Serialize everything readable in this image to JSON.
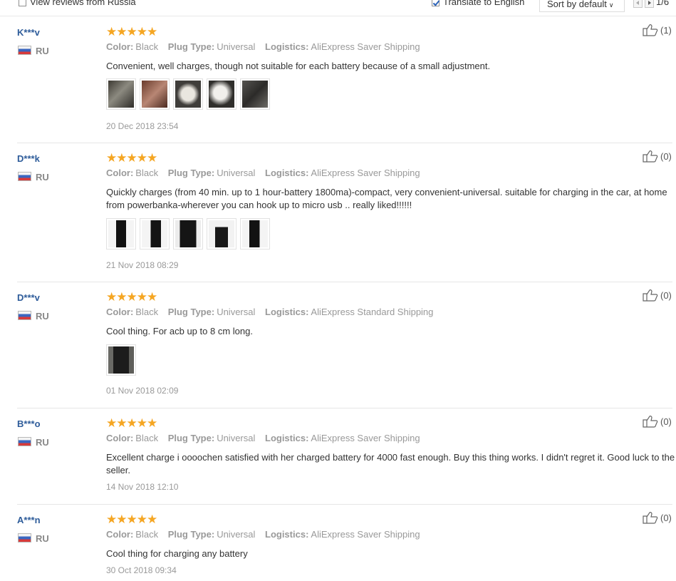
{
  "top_bar": {
    "view_reviews_from": "View reviews from Russia",
    "translate": "Translate to English",
    "sort": "Sort by default",
    "page": "1/6"
  },
  "labels": {
    "color": "Color:",
    "plug_type": "Plug Type:",
    "logistics": "Logistics:"
  },
  "reviews": [
    {
      "name": "K***v",
      "country": "RU",
      "stars": "★★★★★",
      "rating": 5,
      "color": "Black",
      "plug_type": "Universal",
      "logistics": "AliExpress Saver Shipping",
      "text": "Convenient, well charges, though not suitable for each battery because of a small adjustment.",
      "photos": 5,
      "date": "20 Dec 2018 23:54",
      "helpful": "(1)"
    },
    {
      "name": "D***k",
      "country": "RU",
      "stars": "★★★★★",
      "rating": 5,
      "color": "Black",
      "plug_type": "Universal",
      "logistics": "AliExpress Saver Shipping",
      "text": "Quickly charges (from 40 min. up to 1 hour-battery 1800ma)-compact, very convenient-universal. suitable for charging in the car, at home from powerbanka-wherever you can hook up to micro usb .. really liked!!!!!!",
      "photos": 5,
      "date": "21 Nov 2018 08:29",
      "helpful": "(0)"
    },
    {
      "name": "D***v",
      "country": "RU",
      "stars": "★★★★★",
      "rating": 5,
      "color": "Black",
      "plug_type": "Universal",
      "logistics": "AliExpress Standard Shipping",
      "text": "Cool thing. For acb up to 8 cm long.",
      "photos": 1,
      "date": "01 Nov 2018 02:09",
      "helpful": "(0)"
    },
    {
      "name": "B***o",
      "country": "RU",
      "stars": "★★★★★",
      "rating": 5,
      "color": "Black",
      "plug_type": "Universal",
      "logistics": "AliExpress Saver Shipping",
      "text": "Excellent charge i oooochen satisfied with her charged battery for 4000 fast enough. Buy this thing works. I didn't regret it. Good luck to the seller.",
      "photos": 0,
      "date": "14 Nov 2018 12:10",
      "helpful": "(0)"
    },
    {
      "name": "A***n",
      "country": "RU",
      "stars": "★★★★★",
      "rating": 5,
      "color": "Black",
      "plug_type": "Universal",
      "logistics": "AliExpress Saver Shipping",
      "text": "Cool thing for charging any battery",
      "photos": 0,
      "date": "30 Oct 2018 09:34",
      "helpful": "(0)"
    }
  ]
}
